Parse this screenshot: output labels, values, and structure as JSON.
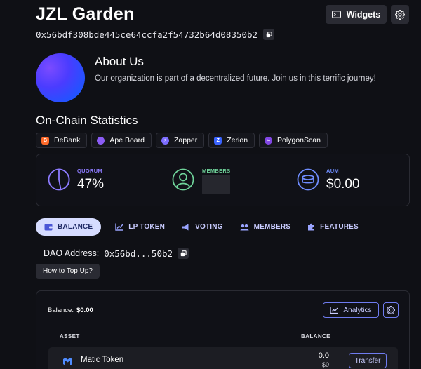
{
  "header": {
    "title": "JZL Garden",
    "address": "0x56bdf308bde445ce64ccfa2f54732b64d08350b2",
    "widgets_label": "Widgets"
  },
  "about": {
    "title": "About Us",
    "description": "Our organization is part of a decentralized future. Join us in this terrific journey!"
  },
  "stats": {
    "title": "On-Chain Statistics",
    "links": [
      {
        "label": "DeBank",
        "icon": "debank-icon",
        "color": "#ff6b2b"
      },
      {
        "label": "Ape Board",
        "icon": "apeboard-icon",
        "color": "#8b5cf6"
      },
      {
        "label": "Zapper",
        "icon": "zapper-icon",
        "color": "#7b6cff"
      },
      {
        "label": "Zerion",
        "icon": "zerion-icon",
        "color": "#3a63ff"
      },
      {
        "label": "PolygonScan",
        "icon": "polygonscan-icon",
        "color": "#8247e5"
      }
    ],
    "quorum": {
      "label": "QUORUM",
      "value": "47%",
      "percent": 47,
      "color": "#8d7bff"
    },
    "members": {
      "label": "MEMBERS",
      "color": "#6fd39a"
    },
    "aum": {
      "label": "AUM",
      "value": "$0.00",
      "color": "#6f8dff"
    }
  },
  "tabs": [
    {
      "label": "BALANCE",
      "icon": "wallet-icon",
      "active": true
    },
    {
      "label": "LP TOKEN",
      "icon": "chart-icon",
      "active": false
    },
    {
      "label": "VOTING",
      "icon": "megaphone-icon",
      "active": false
    },
    {
      "label": "MEMBERS",
      "icon": "people-icon",
      "active": false
    },
    {
      "label": "FEATURES",
      "icon": "puzzle-icon",
      "active": false
    }
  ],
  "dao": {
    "label": "DAO Address:",
    "address_short": "0x56bd...50b2",
    "topup_label": "How to Top Up?"
  },
  "balance": {
    "label": "Balance:",
    "value": "$0.00",
    "analytics_label": "Analytics",
    "col_asset": "ASSET",
    "col_balance": "BALANCE",
    "assets": [
      {
        "name": "Matic Token",
        "amount": "0.0",
        "usd": "$0",
        "action": "Transfer"
      }
    ]
  }
}
